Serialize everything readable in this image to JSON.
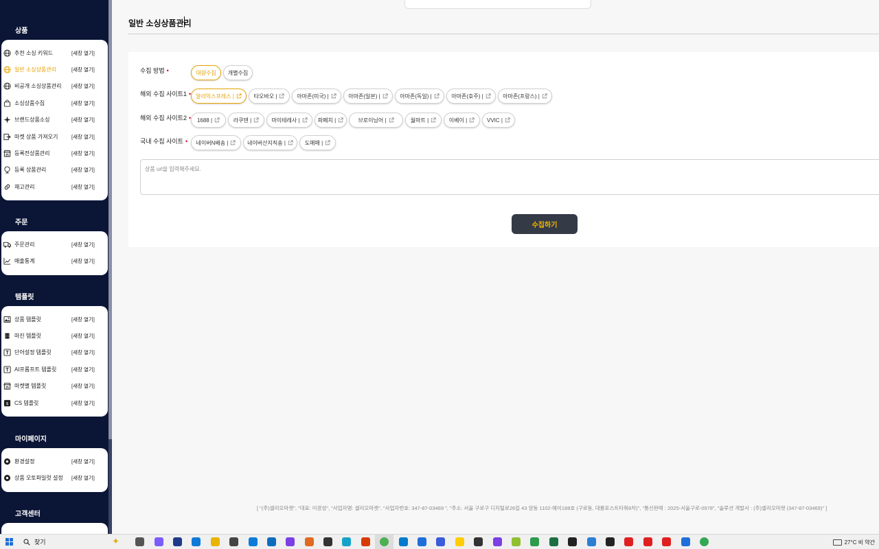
{
  "sidebar": {
    "sections": [
      {
        "title": "상품",
        "items": [
          {
            "icon": "globe-icon",
            "label": "추천 소싱 키워드",
            "open": "[새창 열기]"
          },
          {
            "icon": "globe-icon",
            "label": "일반 소싱상품관리",
            "open": "[새창 열기]",
            "active": true
          },
          {
            "icon": "globe-icon",
            "label": "비공개 소싱상품관리",
            "open": "[새창 열기]"
          },
          {
            "icon": "bag-icon",
            "label": "소싱상품수집",
            "open": "[새창 열기]"
          },
          {
            "icon": "sparkle-icon",
            "label": "브랜드상품소싱",
            "open": "[새창 열기]"
          },
          {
            "icon": "import-icon",
            "label": "마켓 상품 가져오기",
            "open": "[새창 열기]"
          },
          {
            "icon": "store-icon",
            "label": "등록전상품관리",
            "open": "[새창 열기]"
          },
          {
            "icon": "globe-stand-icon",
            "label": "등록 상품관리",
            "open": "[새창 열기]"
          },
          {
            "icon": "link-icon",
            "label": "재고관리",
            "open": "[새창 열기]"
          }
        ]
      },
      {
        "title": "주문",
        "items": [
          {
            "icon": "truck-icon",
            "label": "주문관리",
            "open": "[새창 열기]"
          },
          {
            "icon": "chart-line-icon",
            "label": "매출통계",
            "open": "[새창 열기]"
          }
        ]
      },
      {
        "title": "템플릿",
        "items": [
          {
            "icon": "image-icon",
            "label": "상품 템플릿",
            "open": "[새창 열기]"
          },
          {
            "icon": "coins-icon",
            "label": "마진 템플릿",
            "open": "[새창 열기]"
          },
          {
            "icon": "text-box-icon",
            "label": "단어설정 템플릿",
            "open": "[새창 열기]"
          },
          {
            "icon": "text-box-icon",
            "label": "AI프롬프트 템플릿",
            "open": "[새창 열기]"
          },
          {
            "icon": "store-icon",
            "label": "마켓별 템플릿",
            "open": "[새창 열기]"
          },
          {
            "icon": "cs-icon",
            "label": "CS 템플릿",
            "open": "[새창 열기]"
          }
        ]
      },
      {
        "title": "마이페이지",
        "items": [
          {
            "icon": "settings-icon",
            "label": "환경설정",
            "open": "[새창 열기]"
          },
          {
            "icon": "settings-icon",
            "label": "상품 오토파일럿 설정",
            "open": "[새창 열기]"
          }
        ]
      },
      {
        "title": "고객센터",
        "items": []
      }
    ]
  },
  "main": {
    "title": "일반 소싱상품관리",
    "rows": [
      {
        "label": "수집 방법",
        "chips": [
          {
            "label": "대량수집",
            "selected": true,
            "ext": false
          },
          {
            "label": "개별수집",
            "selected": false,
            "ext": false
          }
        ]
      },
      {
        "label": "해외 수집 사이트1",
        "chips": [
          {
            "label": "알리익스프레스 |",
            "selected": true,
            "ext": true
          },
          {
            "label": "타오바오 |",
            "selected": false,
            "ext": true
          },
          {
            "label": "아마존(미국) |",
            "selected": false,
            "ext": true
          },
          {
            "label": "아마존(일본) |",
            "selected": false,
            "ext": true
          },
          {
            "label": "아마존(독일) |",
            "selected": false,
            "ext": true
          },
          {
            "label": "아마존(호주) |",
            "selected": false,
            "ext": true
          },
          {
            "label": "아마존(프랑스) |",
            "selected": false,
            "ext": true
          }
        ]
      },
      {
        "label": "해외 수집 사이트2",
        "chips": [
          {
            "label": "1688 |",
            "selected": false,
            "ext": true
          },
          {
            "label": "라쿠텐 |",
            "selected": false,
            "ext": true
          },
          {
            "label": "마이테레사 |",
            "selected": false,
            "ext": true
          },
          {
            "label": "파페치 |",
            "selected": false,
            "ext": true
          },
          {
            "label": "브로이닝어 |",
            "selected": false,
            "ext": true
          },
          {
            "label": "월마트 |",
            "selected": false,
            "ext": true
          },
          {
            "label": "이베이 |",
            "selected": false,
            "ext": true
          },
          {
            "label": "VVIC |",
            "selected": false,
            "ext": true
          }
        ]
      },
      {
        "label": "국내 수집 사이트",
        "chips": [
          {
            "label": "네이버N배송 |",
            "selected": false,
            "ext": true
          },
          {
            "label": "네이버산지직송 |",
            "selected": false,
            "ext": true
          },
          {
            "label": "도매매 |",
            "selected": false,
            "ext": true
          }
        ]
      }
    ],
    "url_placeholder": "상품 url을 입력해주세요.",
    "collect_button": "수집하기",
    "footer": "[ \"(주)셀리오마켓\", \"대표: 이광성\", \"사업자명: 셀리오마켓\", \"사업자번호: 347-87-03469 \", \"주소: 서울 구로구 디지털로26길 43 양동 1102-에이188호 (구로동, 대륭포스트타워8차)\", \"통신판매 : 2025-서울구로-0978\", \"솔루션 개발사 : (주)셀리오마켓 (347-87-03469)\" ]"
  },
  "taskbar": {
    "search_label": "찾기",
    "weather": "27°C  비 약간",
    "apps": [
      "task-view",
      "copilot",
      "terminal",
      "edge",
      "file-explorer",
      "store",
      "edge-legacy",
      "outlook",
      "visual-studio",
      "paint",
      "photos",
      "capcut",
      "office",
      "chrome",
      "vscode",
      "maps",
      "word-pad",
      "kakaotalk",
      "game-bar",
      "visual-studio-2",
      "notepad-plus",
      "git",
      "excel",
      "webstorm",
      "notes",
      "console",
      "app-red-1",
      "app-red-2",
      "app-red-3",
      "app-blue",
      "chrome-2"
    ],
    "colors": {
      "accent": "#e6a100",
      "sidebar_bg": "#0b1536",
      "button_bg": "#343a46",
      "button_text": "#f5b800",
      "required": "#d9001b"
    }
  }
}
